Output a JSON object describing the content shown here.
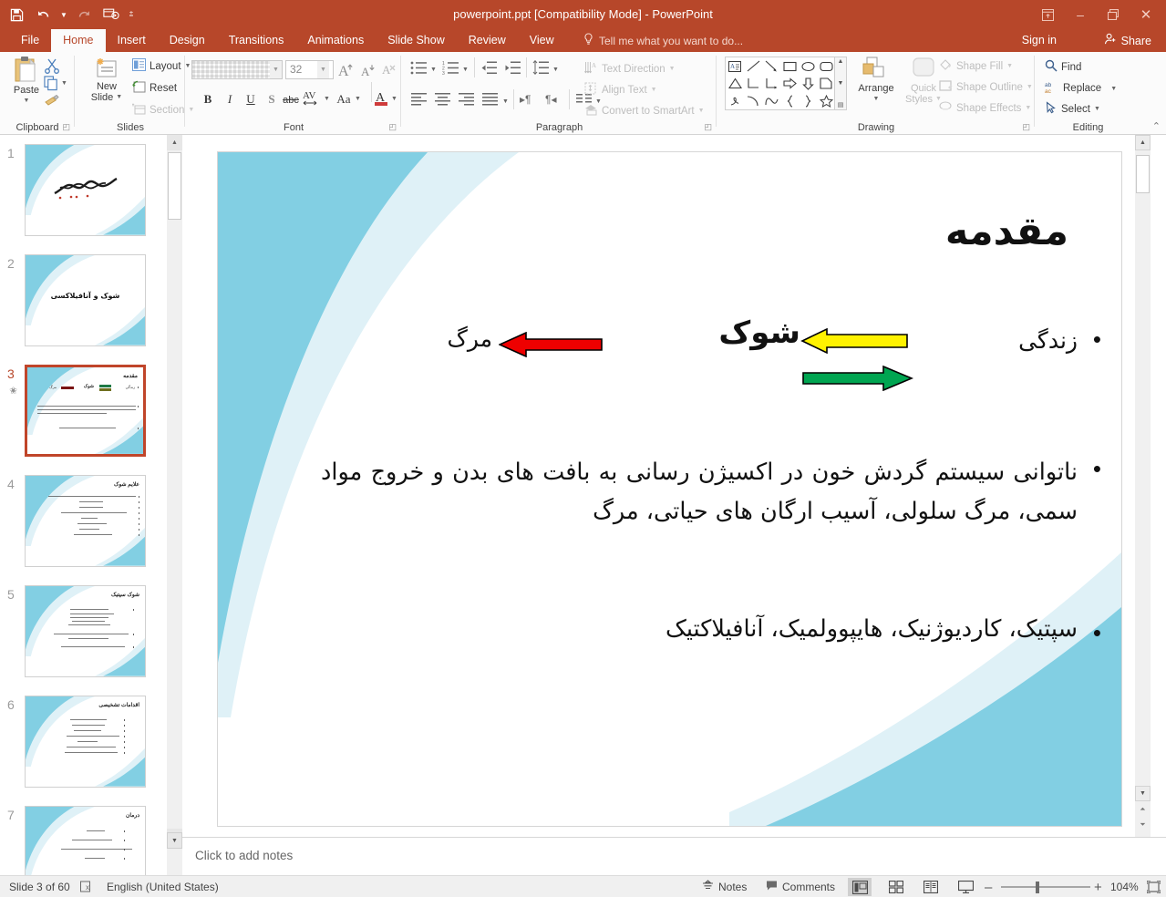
{
  "window": {
    "title": "powerpoint.ppt [Compatibility Mode] - PowerPoint",
    "minimize": "–",
    "restore": "❐",
    "close": "✕",
    "ribbon_display": "ribbon-display-options"
  },
  "quick_access": {
    "save": "Save",
    "undo": "Undo",
    "redo": "Redo",
    "start_slideshow": "Start From Beginning",
    "customize": "Customize Quick Access Toolbar"
  },
  "tabs": [
    {
      "label": "File",
      "active": false
    },
    {
      "label": "Home",
      "active": true
    },
    {
      "label": "Insert",
      "active": false
    },
    {
      "label": "Design",
      "active": false
    },
    {
      "label": "Transitions",
      "active": false
    },
    {
      "label": "Animations",
      "active": false
    },
    {
      "label": "Slide Show",
      "active": false
    },
    {
      "label": "Review",
      "active": false
    },
    {
      "label": "View",
      "active": false
    }
  ],
  "tellme": {
    "placeholder": "Tell me what you want to do..."
  },
  "account": {
    "signin": "Sign in",
    "share": "Share"
  },
  "ribbon": {
    "groups": [
      {
        "name": "Clipboard",
        "label": "Clipboard"
      },
      {
        "name": "Slides",
        "label": "Slides"
      },
      {
        "name": "Font",
        "label": "Font"
      },
      {
        "name": "Paragraph",
        "label": "Paragraph"
      },
      {
        "name": "Drawing",
        "label": "Drawing"
      },
      {
        "name": "Editing",
        "label": "Editing"
      }
    ],
    "clipboard": {
      "paste": "Paste",
      "cut": "Cut",
      "copy": "Copy",
      "format_painter": "Format Painter"
    },
    "slides": {
      "new_slide": "New\nSlide",
      "new_slide_line1": "New",
      "new_slide_line2": "Slide",
      "layout": "Layout",
      "reset": "Reset",
      "section": "Section"
    },
    "font": {
      "font_name": "",
      "font_size": "32",
      "grow": "Increase Font Size",
      "shrink": "Decrease Font Size",
      "clear_formatting": "Clear All Formatting",
      "bold": "B",
      "italic": "I",
      "underline": "U",
      "shadow": "S",
      "strikethrough": "abc",
      "character_spacing": "AV",
      "change_case": "Aa",
      "font_color": "A"
    },
    "paragraph": {
      "text_direction": "Text Direction",
      "align_text": "Align Text",
      "convert_smartart": "Convert to SmartArt"
    },
    "drawing": {
      "arrange": "Arrange",
      "quick_styles_line1": "Quick",
      "quick_styles_line2": "Styles",
      "shape_fill": "Shape Fill",
      "shape_outline": "Shape Outline",
      "shape_effects": "Shape Effects"
    },
    "editing": {
      "find": "Find",
      "replace": "Replace",
      "select": "Select",
      "collapse": "Collapse the Ribbon"
    }
  },
  "thumbnails": [
    {
      "number": "1",
      "title": "",
      "selected": false,
      "animated": false,
      "kind": "bismillah"
    },
    {
      "number": "2",
      "title": "شوک و آنافیلاکسی",
      "selected": false,
      "animated": false,
      "kind": "title"
    },
    {
      "number": "3",
      "title": "مقدمه",
      "selected": true,
      "animated": true,
      "kind": "current"
    },
    {
      "number": "4",
      "title": "علایم شوک",
      "selected": false,
      "animated": false,
      "kind": "bullets8"
    },
    {
      "number": "5",
      "title": "شوک سپتیک",
      "selected": false,
      "animated": false,
      "kind": "bullets11"
    },
    {
      "number": "6",
      "title": "اقدامات تشخیصی",
      "selected": false,
      "animated": false,
      "kind": "bullets7"
    },
    {
      "number": "7",
      "title": "درمان",
      "selected": false,
      "animated": false,
      "kind": "bullets5"
    }
  ],
  "slide": {
    "title": "مقدمه",
    "bullet_glyph": "•",
    "line1_right": "زندگی",
    "line1_center": "شوک",
    "line1_left": "مرگ",
    "bullet2": "ناتوانی سیستم گردش خون در اکسیژن رسانی به بافت های بدن و خروج مواد سمی، مرگ سلولی، آسیب ارگان های حیاتی، مرگ",
    "bullet3": "سپتیک، کاردیوژنیک، هایپوولمیک، آنافیلاکتیک",
    "arrows": [
      {
        "name": "red-left-arrow",
        "color": "#EE0000",
        "direction": "left"
      },
      {
        "name": "yellow-left-arrow",
        "color": "#FFF200",
        "direction": "left"
      },
      {
        "name": "green-right-arrow",
        "color": "#00A551",
        "direction": "right"
      }
    ],
    "theme": {
      "accent": "#82CFE3",
      "accent_light": "#DFF1F7"
    }
  },
  "notes": {
    "placeholder": "Click to add notes"
  },
  "status": {
    "slide_counter": "Slide 3 of 60",
    "language": "English (United States)",
    "spellcheck": "spell-check-icon",
    "notes": "Notes",
    "comments": "Comments",
    "views": [
      "Normal",
      "Slide Sorter",
      "Reading View",
      "Slide Show"
    ],
    "active_view": "Normal",
    "zoom_out": "–",
    "zoom_in": "+",
    "zoom_level": "104%",
    "fit_slide": "Fit slide to current window"
  }
}
